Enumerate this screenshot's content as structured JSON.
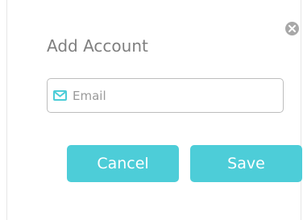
{
  "dialog": {
    "title": "Add Account",
    "email": {
      "placeholder": "Email",
      "value": "",
      "icon": "envelope-icon"
    },
    "buttons": {
      "cancel": "Cancel",
      "save": "Save"
    },
    "close_icon": "close-icon"
  },
  "colors": {
    "accent": "#4dcdd8",
    "title_text": "#7f7f7f",
    "close_icon_bg": "#a8a8a8",
    "field_border": "#bdbdbd"
  }
}
